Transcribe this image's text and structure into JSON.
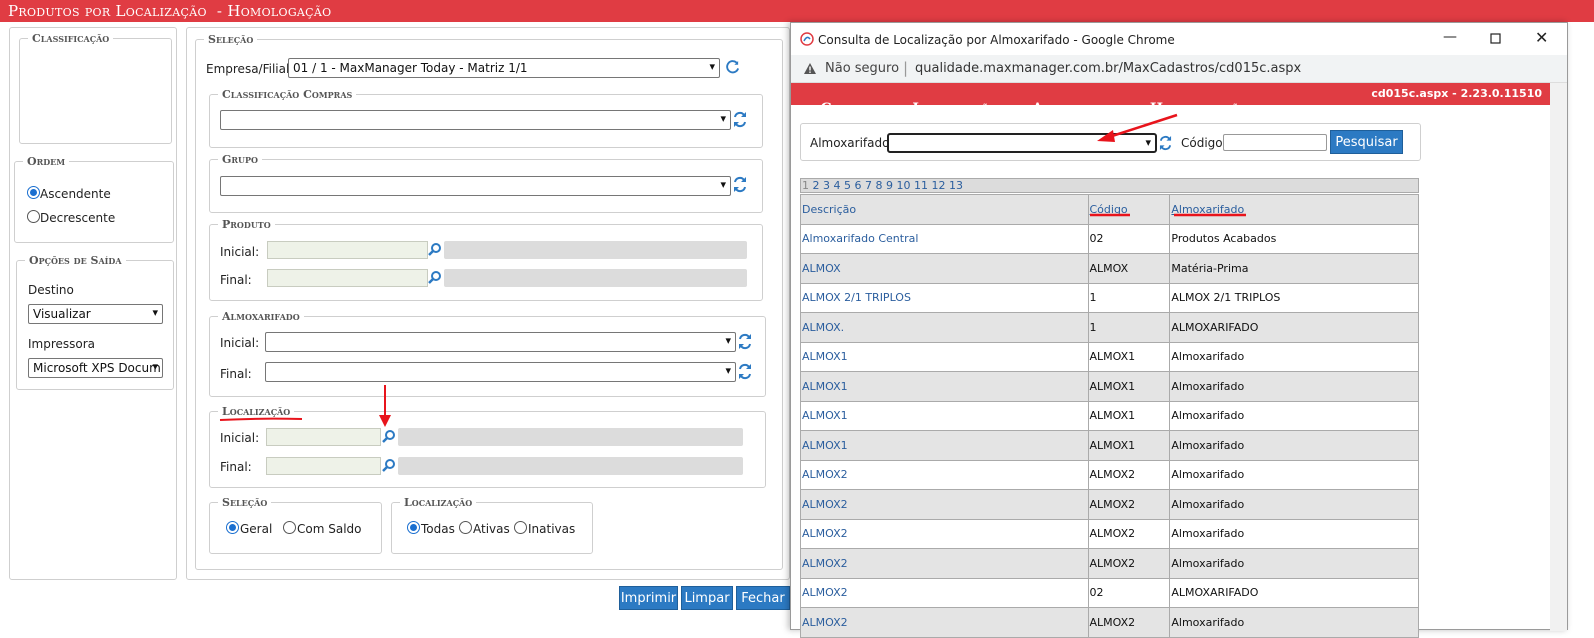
{
  "page": {
    "title": "Produtos por Localização  - Homologação"
  },
  "left": {
    "classificacao_legend": "Classificação",
    "ordem_legend": "Ordem",
    "ordem_options": [
      "Ascendente",
      "Decrescente"
    ],
    "opcoes_legend": "Opções de Saída",
    "destino_label": "Destino",
    "destino_value": "Visualizar",
    "impressora_label": "Impressora",
    "impressora_value": "Microsoft XPS Docum"
  },
  "form": {
    "selecao_legend": "Seleção",
    "empresa_label": "Empresa/Filial:",
    "empresa_value": "01 / 1 - MaxManager Today - Matriz 1/1",
    "classificacao_compras_legend": "Classificação Compras",
    "grupo_legend": "Grupo",
    "produto_legend": "Produto",
    "inicial_label": "Inicial:",
    "final_label": "Final:",
    "almoxarifado_legend": "Almoxarifado",
    "localizacao_legend": "Localização",
    "selecao2_legend": "Seleção",
    "selecao2_options": [
      "Geral",
      "Com Saldo"
    ],
    "localizacao2_legend": "Localização",
    "localizacao2_options": [
      "Todas",
      "Ativas",
      "Inativas"
    ]
  },
  "actions": {
    "imprimir": "Imprimir",
    "limpar": "Limpar",
    "fechar": "Fechar"
  },
  "popup": {
    "window_title": "Consulta de Localização por Almoxarifado - Google Chrome",
    "not_secure": "Não seguro",
    "url": "qualidade.maxmanager.com.br/MaxCadastros/cd015c.aspx",
    "header_title": "Consulta de Localização por Almoxarifado  - Homologação",
    "header_version": "cd015c.aspx - 2.23.0.11510",
    "almoxarifado_label": "Almoxarifado:",
    "codigo_label": "Código:",
    "pesquisar": "Pesquisar",
    "pager_current": "1",
    "pager_pages": [
      "2",
      "3",
      "4",
      "5",
      "6",
      "7",
      "8",
      "9",
      "10",
      "11",
      "12",
      "13"
    ],
    "columns": [
      "Descrição",
      "Código",
      "Almoxarifado"
    ],
    "rows": [
      {
        "descricao": "Almoxarifado Central",
        "codigo": "02",
        "almoxarifado": "Produtos Acabados"
      },
      {
        "descricao": "ALMOX",
        "codigo": "ALMOX",
        "almoxarifado": "Matéria-Prima"
      },
      {
        "descricao": "ALMOX 2/1 TRIPLOS",
        "codigo": "1",
        "almoxarifado": "ALMOX 2/1 TRIPLOS"
      },
      {
        "descricao": "ALMOX.",
        "codigo": "1",
        "almoxarifado": "ALMOXARIFADO"
      },
      {
        "descricao": "ALMOX1",
        "codigo": "ALMOX1",
        "almoxarifado": "Almoxarifado"
      },
      {
        "descricao": "ALMOX1",
        "codigo": "ALMOX1",
        "almoxarifado": "Almoxarifado"
      },
      {
        "descricao": "ALMOX1",
        "codigo": "ALMOX1",
        "almoxarifado": "Almoxarifado"
      },
      {
        "descricao": "ALMOX1",
        "codigo": "ALMOX1",
        "almoxarifado": "Almoxarifado"
      },
      {
        "descricao": "ALMOX2",
        "codigo": "ALMOX2",
        "almoxarifado": "Almoxarifado"
      },
      {
        "descricao": "ALMOX2",
        "codigo": "ALMOX2",
        "almoxarifado": "Almoxarifado"
      },
      {
        "descricao": "ALMOX2",
        "codigo": "ALMOX2",
        "almoxarifado": "Almoxarifado"
      },
      {
        "descricao": "ALMOX2",
        "codigo": "ALMOX2",
        "almoxarifado": "Almoxarifado"
      },
      {
        "descricao": "ALMOX2",
        "codigo": "02",
        "almoxarifado": "ALMOXARIFADO"
      },
      {
        "descricao": "ALMOX2",
        "codigo": "ALMOX2",
        "almoxarifado": "Almoxarifado"
      }
    ]
  },
  "colors": {
    "header_red": "#e03c43",
    "button_blue": "#2c7ac3",
    "link_blue": "#2b5e9e",
    "annotation_red": "#e8141c"
  }
}
